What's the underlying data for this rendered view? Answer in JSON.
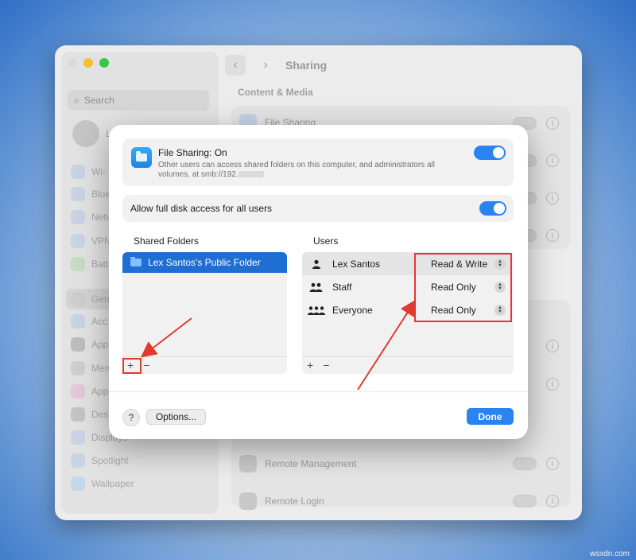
{
  "background_window": {
    "title": "Sharing",
    "search_placeholder": "Search",
    "user_name": "Le",
    "section_title": "Content & Media",
    "sidebar_items": [
      "Wi-",
      "Blue",
      "Netv",
      "VPN",
      "Batt",
      "Gen",
      "Acc",
      "App",
      "Men",
      "App",
      "Desl",
      "Displays",
      "Spotlight",
      "Wallpaper"
    ],
    "rows": [
      {
        "label": "File Sharing"
      },
      {
        "label": "Remote Management"
      },
      {
        "label": "Remote Login"
      }
    ],
    "back_icon": "chevron-left-icon",
    "forward_icon": "chevron-right-icon"
  },
  "dialog": {
    "file_sharing": {
      "title": "File Sharing: On",
      "description": "Other users can access shared folders on this computer, and administrators all volumes, at smb://192.",
      "enabled": true
    },
    "full_disk": {
      "label": "Allow full disk access for all users",
      "enabled": true
    },
    "shared_folders": {
      "header": "Shared Folders",
      "items": [
        "Lex Santos's Public Folder"
      ],
      "add_label": "+",
      "remove_label": "−"
    },
    "users": {
      "header": "Users",
      "rows": [
        {
          "name": "Lex Santos",
          "permission": "Read & Write",
          "icon": "person-icon"
        },
        {
          "name": "Staff",
          "permission": "Read Only",
          "icon": "two-people-icon"
        },
        {
          "name": "Everyone",
          "permission": "Read Only",
          "icon": "group-icon"
        }
      ],
      "add_label": "+",
      "remove_label": "−"
    },
    "help_label": "?",
    "options_label": "Options...",
    "done_label": "Done"
  },
  "colors": {
    "accent": "#2a84f0",
    "selection": "#1f6ed4",
    "annotation": "#e03a2f"
  },
  "watermark": "wsxdn.com"
}
